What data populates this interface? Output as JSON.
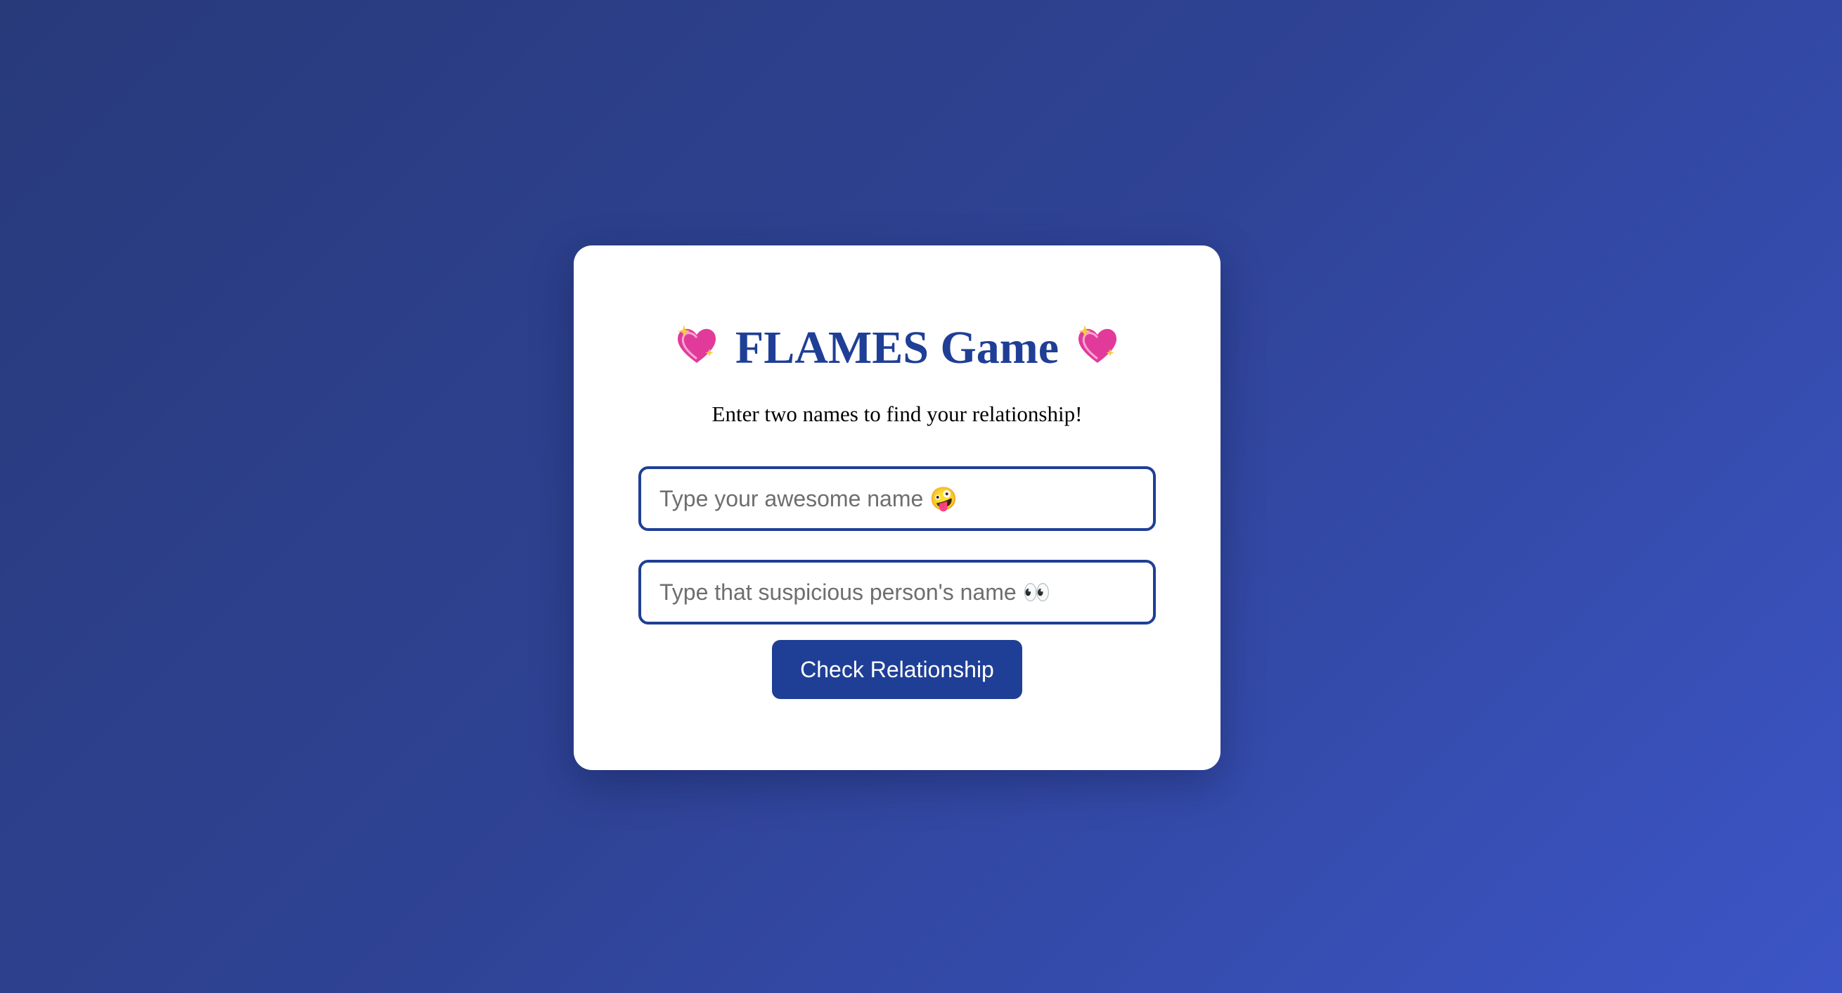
{
  "app": {
    "title": "FLAMES Game",
    "subtitle": "Enter two names to find your relationship!",
    "title_icon": "sparkling-heart-icon"
  },
  "form": {
    "name1_placeholder": "Type your awesome name 🤪",
    "name2_placeholder": "Type that suspicious person's name 👀",
    "name1_value": "",
    "name2_value": "",
    "submit_label": "Check Relationship"
  },
  "colors": {
    "accent": "#1f3f96",
    "background_start": "#283a7a",
    "background_end": "#3c55c6",
    "card": "#ffffff"
  }
}
